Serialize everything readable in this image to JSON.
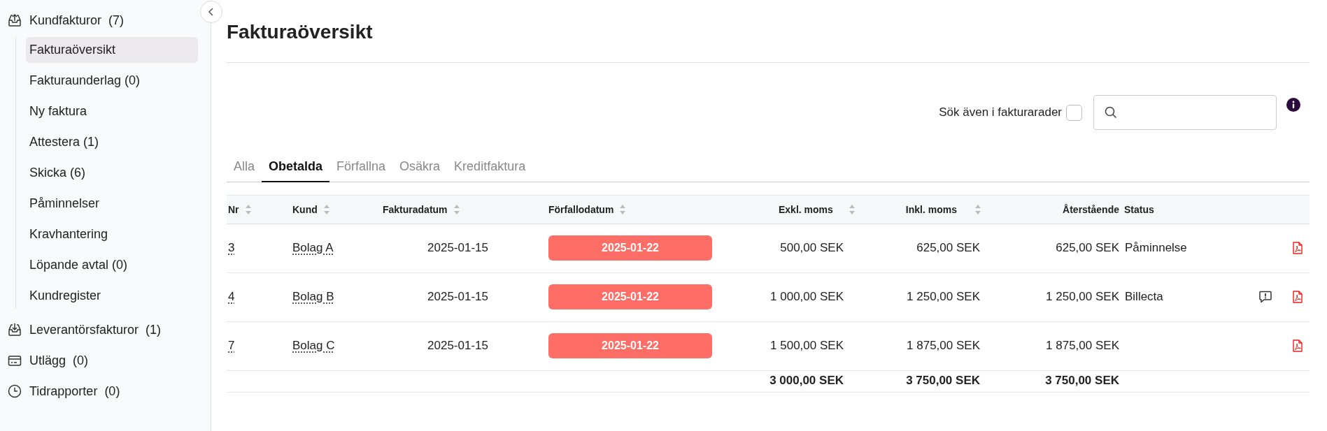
{
  "sidebar": {
    "groups": [
      {
        "label": "Kundfakturor",
        "count": "(7)",
        "children": [
          {
            "label": "Fakturaöversikt",
            "selected": true
          },
          {
            "label": "Fakturaunderlag (0)",
            "selected": false
          },
          {
            "label": "Ny faktura",
            "selected": false
          },
          {
            "label": "Attestera (1)",
            "selected": false
          },
          {
            "label": "Skicka (6)",
            "selected": false
          },
          {
            "label": "Påminnelser",
            "selected": false
          },
          {
            "label": "Kravhantering",
            "selected": false
          },
          {
            "label": "Löpande avtal (0)",
            "selected": false
          },
          {
            "label": "Kundregister",
            "selected": false
          }
        ]
      },
      {
        "label": "Leverantörsfakturor",
        "count": "(1)"
      },
      {
        "label": "Utlägg",
        "count": "(0)"
      },
      {
        "label": "Tidrapporter",
        "count": "(0)"
      }
    ]
  },
  "page": {
    "title": "Fakturaöversikt"
  },
  "search": {
    "checkbox_label": "Sök även i fakturarader",
    "checked": false
  },
  "tabs": [
    {
      "label": "Alla",
      "selected": false
    },
    {
      "label": "Obetalda",
      "selected": true
    },
    {
      "label": "Förfallna",
      "selected": false
    },
    {
      "label": "Osäkra",
      "selected": false
    },
    {
      "label": "Kreditfaktura",
      "selected": false
    }
  ],
  "table": {
    "columns": [
      {
        "label": "Nr",
        "sortable": true
      },
      {
        "label": "Kund",
        "sortable": true
      },
      {
        "label": "Fakturadatum",
        "sortable": true
      },
      {
        "label": "Förfallodatum",
        "sortable": true
      },
      {
        "label": "Exkl. moms",
        "sortable": true
      },
      {
        "label": "Inkl. moms",
        "sortable": true
      },
      {
        "label": "Återstående",
        "sortable": false
      },
      {
        "label": "Status",
        "sortable": false
      }
    ],
    "rows": [
      {
        "nr": "3",
        "customer": "Bolag A",
        "invoice_date": "2025-01-15",
        "due_date": "2025-01-22",
        "overdue": true,
        "excl": "500,00 SEK",
        "incl": "625,00 SEK",
        "remaining": "625,00 SEK",
        "status": "Påminnelse",
        "comment": false,
        "pdf": true
      },
      {
        "nr": "4",
        "customer": "Bolag B",
        "invoice_date": "2025-01-15",
        "due_date": "2025-01-22",
        "overdue": true,
        "excl": "1 000,00 SEK",
        "incl": "1 250,00 SEK",
        "remaining": "1 250,00 SEK",
        "status": "Billecta",
        "comment": true,
        "pdf": true
      },
      {
        "nr": "7",
        "customer": "Bolag C",
        "invoice_date": "2025-01-15",
        "due_date": "2025-01-22",
        "overdue": true,
        "excl": "1 500,00 SEK",
        "incl": "1 875,00 SEK",
        "remaining": "1 875,00 SEK",
        "comment": false,
        "pdf": true
      }
    ],
    "totals": {
      "excl": "3 000,00 SEK",
      "incl": "3 750,00 SEK",
      "remaining": "3 750,00 SEK"
    }
  }
}
